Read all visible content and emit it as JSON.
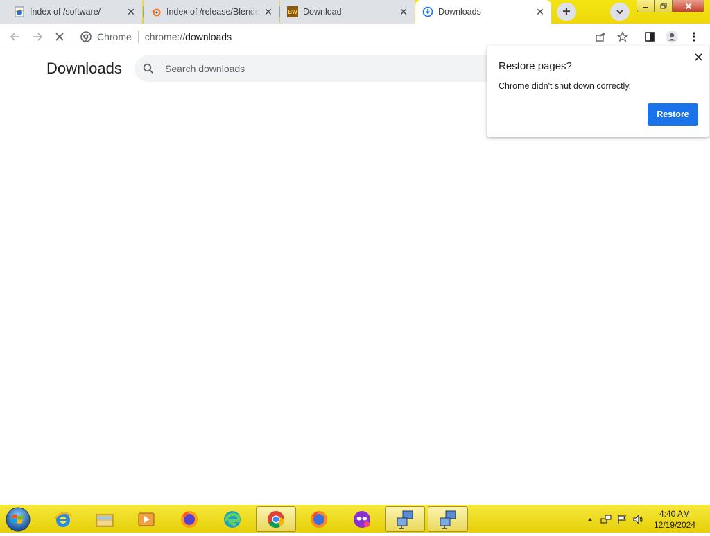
{
  "tabs": [
    {
      "title": "Index of /software/",
      "favicon": "ie-page-icon"
    },
    {
      "title": "Index of /release/Blender",
      "favicon": "blender-icon"
    },
    {
      "title": "Download",
      "favicon": "bw-icon",
      "favicon_text": "BW"
    },
    {
      "title": "Downloads",
      "favicon": "downloads-icon"
    }
  ],
  "toolbar": {
    "site_label": "Chrome",
    "url_scheme": "chrome://",
    "url_host": "downloads"
  },
  "downloads": {
    "title": "Downloads",
    "search_placeholder": "Search downloads"
  },
  "restore_bubble": {
    "title": "Restore pages?",
    "message": "Chrome didn't shut down correctly.",
    "button": "Restore"
  },
  "taskbar": {
    "items": [
      "internet-explorer",
      "file-explorer",
      "media-player",
      "firefox",
      "edge",
      "chrome",
      "firefox",
      "privacy-browser",
      "remote-desktop",
      "remote-desktop"
    ],
    "clock_time": "4:40 AM",
    "clock_date": "12/19/2024"
  },
  "colors": {
    "accent": "#1a73e8",
    "taskbar": "#f0dc1a",
    "tabstrip": "#f1e210"
  }
}
